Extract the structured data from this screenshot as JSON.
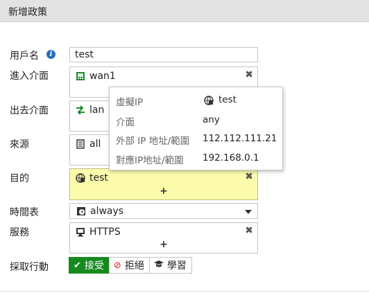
{
  "dialog": {
    "title": "新增政策"
  },
  "fields": {
    "user_label": "用戶名",
    "user_value": "test",
    "incoming_label": "進入介面",
    "incoming_value": "wan1",
    "outgoing_label": "出去介面",
    "outgoing_value": "lan",
    "source_label": "來源",
    "source_value": "all",
    "destination_label": "目的",
    "destination_value": "test",
    "schedule_label": "時間表",
    "schedule_value": "always",
    "service_label": "服務",
    "service_value": "HTTPS",
    "action_label": "採取行動",
    "plus": "+"
  },
  "actions": {
    "accept": "接受",
    "deny": "拒絕",
    "learn": "學習"
  },
  "tooltip": {
    "vip_key": "虛擬IP",
    "vip_value": "test",
    "iface_key": "介面",
    "iface_value": "any",
    "ext_key": "外部 IP 地址/範圍",
    "ext_value": "112.112.111.21",
    "mapped_key": "對應IP地址/範圍",
    "mapped_value": "192.168.0.1"
  },
  "colors": {
    "accept": "#178a1f",
    "highlight": "#fcfcac",
    "info": "#2a6ebc"
  },
  "icons": [
    "info-icon",
    "interface-icon",
    "remove-icon",
    "swap-arrows-icon",
    "address-icon",
    "vip-icon",
    "clock-icon",
    "service-icon",
    "check-icon",
    "deny-icon",
    "graduation-cap-icon"
  ]
}
